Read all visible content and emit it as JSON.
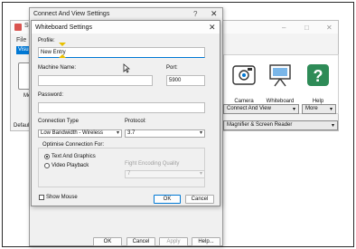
{
  "background_window": {
    "title": "Sy",
    "menu_file": "File",
    "menu_tab": "Visu",
    "left_tool_label": "Me",
    "footer_left": "Default",
    "toolbar": [
      {
        "label": "Camera",
        "icon": "camera-icon"
      },
      {
        "label": "Whiteboard",
        "icon": "whiteboard-icon"
      },
      {
        "label": "Help",
        "icon": "help-icon"
      }
    ],
    "connect_and_view_dropdown": "Connect And View",
    "more_dropdown": "More",
    "magnifier_dropdown": "Magnifier & Screen Reader"
  },
  "connect_dialog": {
    "title": "Connect And View Settings",
    "help_glyph": "?",
    "close_glyph": "✕",
    "buttons": {
      "ok": "OK",
      "cancel": "Cancel",
      "apply": "Apply",
      "help": "Help..."
    }
  },
  "whiteboard_dialog": {
    "title": "Whiteboard Settings",
    "close_glyph": "✕",
    "profile": {
      "label": "Profile:",
      "value": "New Entry"
    },
    "machine_name": {
      "label": "Machine Name:",
      "value": ""
    },
    "port": {
      "label": "Port:",
      "value": "5900"
    },
    "password": {
      "label": "Password:",
      "value": ""
    },
    "connection_type": {
      "label": "Connection Type",
      "value": "Low Bandwidth - Wireless"
    },
    "protocol": {
      "label": "Protocol:",
      "value": "3.7"
    },
    "optimise": {
      "label": "Optimise Connection For:",
      "options": [
        {
          "label": "Text And Graphics",
          "selected": true
        },
        {
          "label": "Video Playback",
          "selected": false
        }
      ],
      "frame_quality_label": "Fight Encoding Quality",
      "frame_quality_value": "7"
    },
    "show_mouse": {
      "label": "Show Mouse",
      "checked": false
    },
    "buttons": {
      "ok": "OK",
      "cancel": "Cancel"
    }
  },
  "colors": {
    "accent": "#0078d4",
    "dialog_bg": "#f0f0f0",
    "help_icon_bg": "#2e8b57"
  }
}
